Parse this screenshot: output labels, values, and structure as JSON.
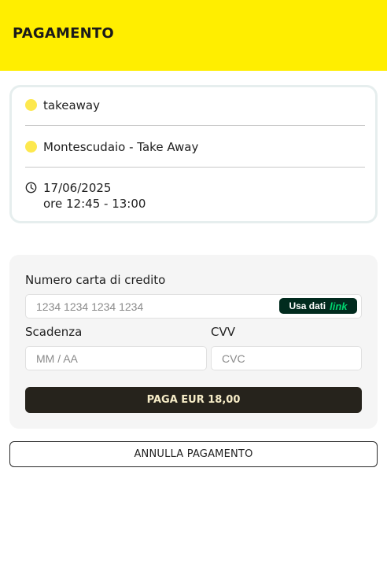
{
  "header": {
    "title": "PAGAMENTO",
    "background": "#ffee00"
  },
  "order_summary": {
    "service_type": "takeaway",
    "location": "Montescudaio - Take Away",
    "date": "17/06/2025",
    "time_slot": "ore 12:45 - 13:00",
    "dot_color": "#fde84e",
    "icons": {
      "date": "clock-icon"
    }
  },
  "payment_form": {
    "card_number": {
      "label": "Numero carta di credito",
      "placeholder": "1234 1234 1234 1234",
      "value": ""
    },
    "link_badge": {
      "prefix": "Usa dati",
      "brand": "link",
      "brand_color": "#00d66f"
    },
    "expiry": {
      "label": "Scadenza",
      "placeholder": "MM / AA",
      "value": ""
    },
    "cvv": {
      "label": "CVV",
      "placeholder": "CVC",
      "value": ""
    },
    "pay_button": {
      "label": "PAGA EUR 18,00",
      "background": "#26231c"
    }
  },
  "cancel_button": {
    "label": "ANNULLA PAGAMENTO"
  }
}
